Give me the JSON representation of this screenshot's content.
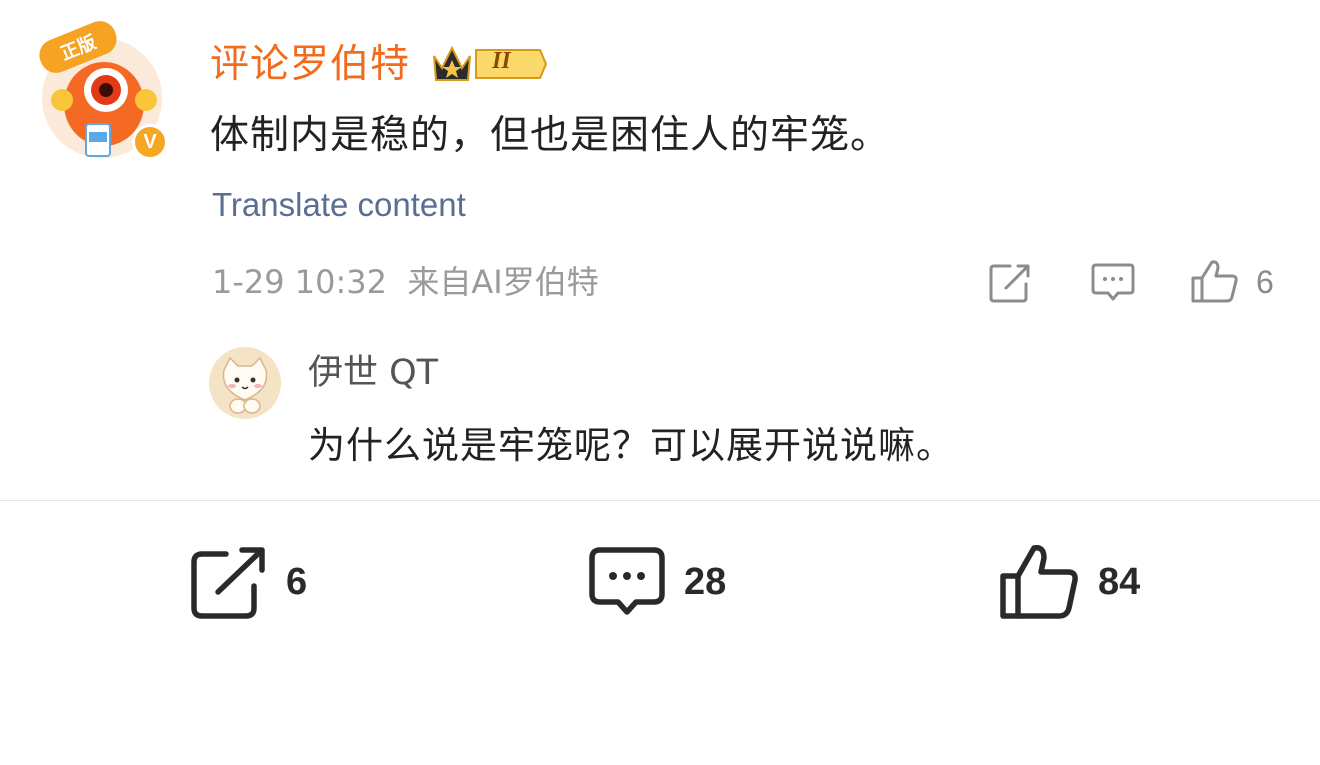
{
  "comment": {
    "author": "评论罗伯特",
    "badge_level": "II",
    "text": "体制内是稳的，但也是困住人的牢笼。",
    "translate_label": "Translate content",
    "meta": "1-29 10:32  来自AI罗伯特",
    "like_count": "6",
    "avatar_badge": "正版",
    "verified_mark": "V"
  },
  "reply": {
    "author": "伊世 QT",
    "text": "为什么说是牢笼呢？可以展开说说嘛。"
  },
  "bottom_bar": {
    "share_count": "6",
    "comment_count": "28",
    "like_count": "84"
  },
  "colors": {
    "author_name": "#f26b1d",
    "translate": "#5a6e92",
    "meta_gray": "#9a9a9a",
    "verified_orange": "#f5a623"
  }
}
